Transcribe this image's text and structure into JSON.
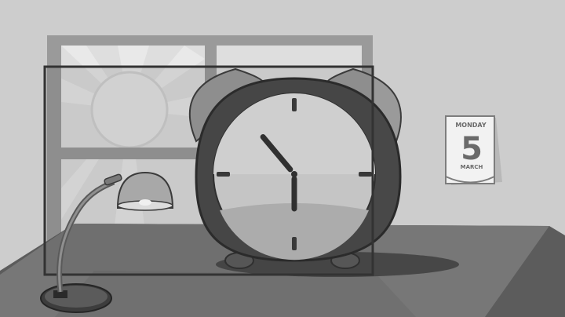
{
  "calendar": {
    "weekday": "MONDAY",
    "day": "5",
    "month": "MARCH"
  },
  "clock": {
    "hour_hand_points_to": 11,
    "minute_hand_points_to": 6
  },
  "icons": {
    "clock": "alarm-clock-icon",
    "lamp": "desk-lamp-icon",
    "sun": "sun-icon",
    "calendar": "tear-off-calendar-icon"
  }
}
